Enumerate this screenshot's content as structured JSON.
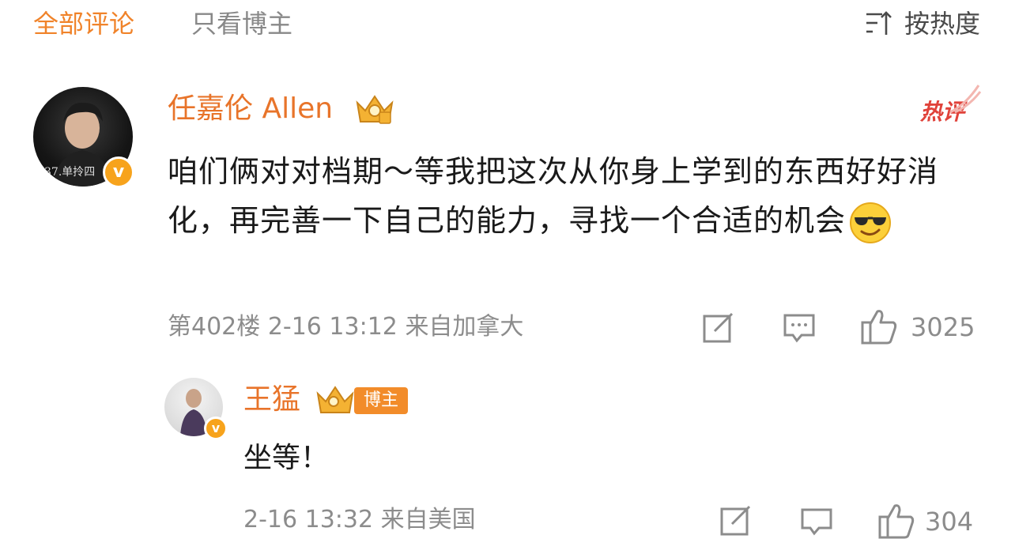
{
  "tabs": {
    "all_comments": "全部评论",
    "only_blogger": "只看博主",
    "sort_label": "按热度"
  },
  "comment": {
    "username": "任嘉伦 Allen",
    "hot_label": "热评",
    "avatar_caption": "37.单拎四",
    "text": "咱们俩对对档期～等我把这次从你身上学到的东西好好消化，再完善一下自己的能力，寻找一个合适的机会",
    "emoji": "sunglasses-smiley",
    "floor": "第402楼",
    "time": "2-16 13:12",
    "location": "来自加拿大",
    "likes": "3025"
  },
  "reply": {
    "username": "王猛",
    "badge": "博主",
    "text": "坐等！",
    "time": "2-16 13:32",
    "location": "来自美国",
    "likes": "304"
  },
  "colors": {
    "accent": "#f0832a",
    "username": "#e8742a",
    "hot": "#e0423a",
    "meta": "#8c8c8c"
  },
  "icons": [
    "sort-icon",
    "crown-icon",
    "v-verified-icon",
    "edit-icon",
    "comment-icon",
    "like-icon"
  ]
}
